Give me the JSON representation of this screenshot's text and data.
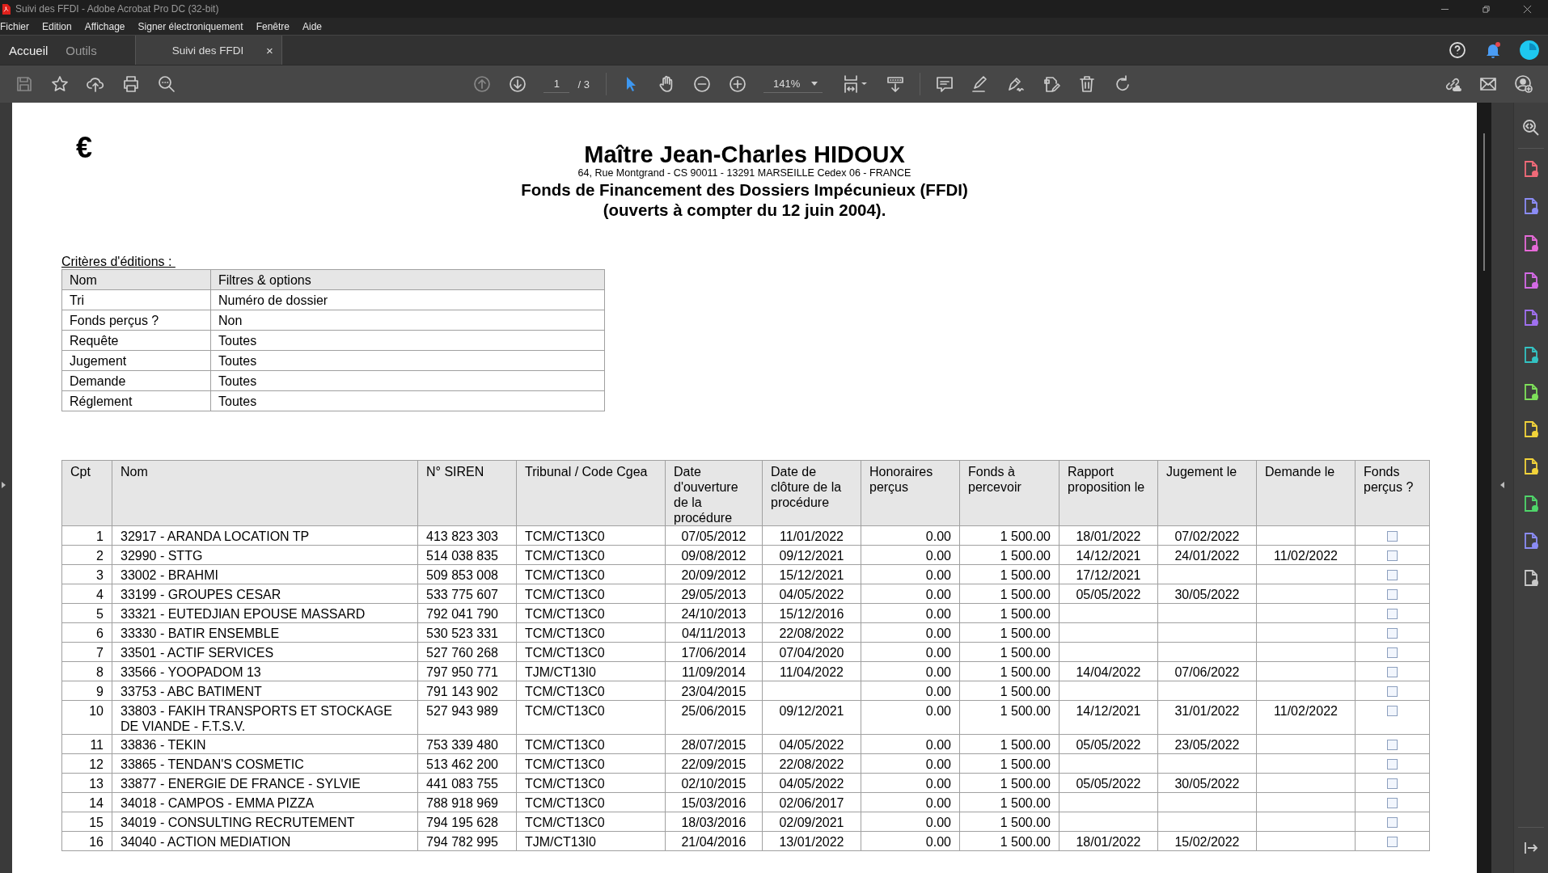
{
  "window": {
    "title": "Suivi des FFDI - Adobe Acrobat Pro DC (32-bit)"
  },
  "menu": [
    "Fichier",
    "Edition",
    "Affichage",
    "Signer électroniquement",
    "Fenêtre",
    "Aide"
  ],
  "tabs": [
    {
      "label": "Accueil",
      "selected": true
    },
    {
      "label": "Outils",
      "selected": false
    }
  ],
  "document_tab": {
    "label": "Suivi des FFDI",
    "close": "×"
  },
  "toolbar": {
    "page": "1",
    "page_count": "/ 3",
    "zoom": "141%"
  },
  "document": {
    "logo": "€",
    "title": "Maître Jean-Charles HIDOUX",
    "address": "64, Rue Montgrand - CS 90011 - 13291 MARSEILLE Cedex 06 - FRANCE",
    "subtitle": "Fonds de Financement des Dossiers Impécunieux (FFDI)",
    "subtitle_2": "(ouverts à compter du 12 juin 2004).",
    "criteria": {
      "title": "Critères d'éditions :",
      "columns": [
        "Nom",
        "Filtres & options"
      ],
      "rows": [
        [
          "Tri",
          "Numéro de dossier"
        ],
        [
          "Fonds perçus ?",
          "Non"
        ],
        [
          "Requête",
          "Toutes"
        ],
        [
          "Jugement",
          "Toutes"
        ],
        [
          "Demande",
          "Toutes"
        ],
        [
          "Réglement",
          "Toutes"
        ]
      ]
    },
    "table": {
      "columns": [
        "Cpt",
        "Nom",
        "N° SIREN",
        "Tribunal / Code Cgea",
        "Date d'ouverture de la procédure",
        "Date de clôture de la procédure",
        "Honoraires perçus",
        "Fonds à percevoir",
        "Rapport proposition le",
        "Jugement le",
        "Demande le",
        "Fonds perçus ?"
      ],
      "rows": [
        {
          "cpt": "1",
          "nom": "32917 - ARANDA LOCATION TP",
          "siren": "413 823 303",
          "tribunal": "TCM/CT13C0",
          "ouverture": "07/05/2012",
          "cloture": "11/01/2022",
          "honoraires": "0.00",
          "fonds": "1 500.00",
          "rapport": "18/01/2022",
          "jugement": "07/02/2022",
          "fonds_percus": false
        },
        {
          "cpt": "2",
          "nom": "32990 - STTG",
          "siren": "514 038 835",
          "tribunal": "TCM/CT13C0",
          "ouverture": "09/08/2012",
          "cloture": "09/12/2021",
          "honoraires": "0.00",
          "fonds": "1 500.00",
          "rapport": "14/12/2021",
          "jugement": "24/01/2022",
          "demande": "11/02/2022",
          "fonds_percus": false
        },
        {
          "cpt": "3",
          "nom": "33002 - BRAHMI",
          "siren": "509 853 008",
          "tribunal": "TCM/CT13C0",
          "ouverture": "20/09/2012",
          "cloture": "15/12/2021",
          "honoraires": "0.00",
          "fonds": "1 500.00",
          "rapport": "17/12/2021",
          "fonds_percus": false
        },
        {
          "cpt": "4",
          "nom": "33199 - GROUPES CESAR",
          "siren": "533 775 607",
          "tribunal": "TCM/CT13C0",
          "ouverture": "29/05/2013",
          "cloture": "04/05/2022",
          "honoraires": "0.00",
          "fonds": "1 500.00",
          "rapport": "05/05/2022",
          "jugement": "30/05/2022",
          "fonds_percus": false
        },
        {
          "cpt": "5",
          "nom": "33321 - EUTEDJIAN EPOUSE MASSARD",
          "siren": "792 041 790",
          "tribunal": "TCM/CT13C0",
          "ouverture": "24/10/2013",
          "cloture": "15/12/2016",
          "honoraires": "0.00",
          "fonds": "1 500.00",
          "fonds_percus": false
        },
        {
          "cpt": "6",
          "nom": "33330 - BATIR ENSEMBLE",
          "siren": "530 523 331",
          "tribunal": "TCM/CT13C0",
          "ouverture": "04/11/2013",
          "cloture": "22/08/2022",
          "honoraires": "0.00",
          "fonds": "1 500.00",
          "fonds_percus": false
        },
        {
          "cpt": "7",
          "nom": "33501 - ACTIF SERVICES",
          "siren": "527 760 268",
          "tribunal": "TCM/CT13C0",
          "ouverture": "17/06/2014",
          "cloture": "07/04/2020",
          "honoraires": "0.00",
          "fonds": "1 500.00",
          "fonds_percus": false
        },
        {
          "cpt": "8",
          "nom": "33566 - YOOPADOM 13",
          "siren": "797 950 771",
          "tribunal": "TJM/CT13I0",
          "ouverture": "11/09/2014",
          "cloture": "11/04/2022",
          "honoraires": "0.00",
          "fonds": "1 500.00",
          "rapport": "14/04/2022",
          "jugement": "07/06/2022",
          "fonds_percus": false
        },
        {
          "cpt": "9",
          "nom": "33753 - ABC BATIMENT",
          "siren": "791 143 902",
          "tribunal": "TCM/CT13C0",
          "ouverture": "23/04/2015",
          "honoraires": "0.00",
          "fonds": "1 500.00",
          "fonds_percus": false
        },
        {
          "cpt": "10",
          "nom": "33803 - FAKIH TRANSPORTS ET STOCKAGE DE VIANDE - F.T.S.V.",
          "siren": "527 943 989",
          "tribunal": "TCM/CT13C0",
          "ouverture": "25/06/2015",
          "cloture": "09/12/2021",
          "honoraires": "0.00",
          "fonds": "1 500.00",
          "rapport": "14/12/2021",
          "jugement": "31/01/2022",
          "demande": "11/02/2022",
          "fonds_percus": false
        },
        {
          "cpt": "11",
          "nom": "33836 - TEKIN",
          "siren": "753 339 480",
          "tribunal": "TCM/CT13C0",
          "ouverture": "28/07/2015",
          "cloture": "04/05/2022",
          "honoraires": "0.00",
          "fonds": "1 500.00",
          "rapport": "05/05/2022",
          "jugement": "23/05/2022",
          "fonds_percus": false
        },
        {
          "cpt": "12",
          "nom": "33865 - TENDAN'S COSMETIC",
          "siren": "513 462 200",
          "tribunal": "TCM/CT13C0",
          "ouverture": "22/09/2015",
          "cloture": "22/08/2022",
          "honoraires": "0.00",
          "fonds": "1 500.00",
          "fonds_percus": false
        },
        {
          "cpt": "13",
          "nom": "33877 - ENERGIE DE FRANCE - SYLVIE",
          "siren": "441 083 755",
          "tribunal": "TCM/CT13C0",
          "ouverture": "02/10/2015",
          "cloture": "04/05/2022",
          "honoraires": "0.00",
          "fonds": "1 500.00",
          "rapport": "05/05/2022",
          "jugement": "30/05/2022",
          "fonds_percus": false
        },
        {
          "cpt": "14",
          "nom": "34018 - CAMPOS - EMMA PIZZA",
          "siren": "788 918 969",
          "tribunal": "TCM/CT13C0",
          "ouverture": "15/03/2016",
          "cloture": "02/06/2017",
          "honoraires": "0.00",
          "fonds": "1 500.00",
          "fonds_percus": false
        },
        {
          "cpt": "15",
          "nom": "34019 - CONSULTING RECRUTEMENT",
          "siren": "794 195 628",
          "tribunal": "TCM/CT13C0",
          "ouverture": "18/03/2016",
          "cloture": "02/09/2021",
          "honoraires": "0.00",
          "fonds": "1 500.00",
          "fonds_percus": false
        },
        {
          "cpt": "16",
          "nom": "34040 - ACTION MEDIATION",
          "siren": "794 782 995",
          "tribunal": "TJM/CT13I0",
          "ouverture": "21/04/2016",
          "cloture": "13/01/2022",
          "honoraires": "0.00",
          "fonds": "1 500.00",
          "rapport": "18/01/2022",
          "jugement": "15/02/2022",
          "fonds_percus": false
        }
      ]
    }
  }
}
